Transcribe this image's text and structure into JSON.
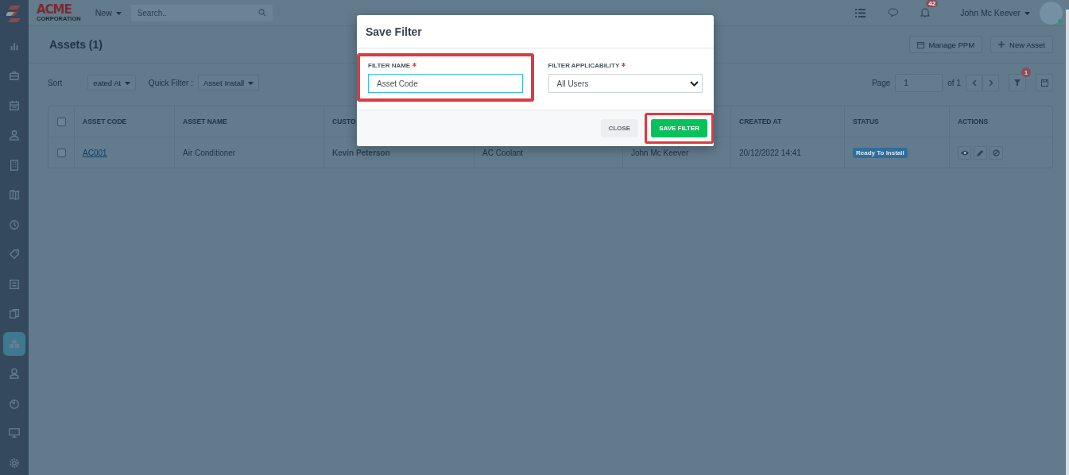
{
  "sidebar": {
    "items": [
      {
        "selected": false
      },
      {
        "selected": false
      },
      {
        "selected": false
      },
      {
        "selected": false
      },
      {
        "selected": false
      },
      {
        "selected": false
      },
      {
        "selected": false
      },
      {
        "selected": false
      },
      {
        "selected": false
      },
      {
        "selected": false
      },
      {
        "selected": true
      },
      {
        "selected": false
      },
      {
        "selected": false
      },
      {
        "selected": false
      },
      {
        "selected": false
      }
    ]
  },
  "topbar": {
    "logo": {
      "name": "ACME",
      "tagline": "CORPORATION"
    },
    "new_menu": "New",
    "search": {
      "placeholder": "Search.."
    },
    "notifications": "42",
    "user": "John Mc Keever"
  },
  "page": {
    "title": "Assets (1)",
    "buttons": [
      "Manage PPM",
      "New Asset"
    ]
  },
  "toolbar": {
    "sort_label": "Sort",
    "sort_value": "eated At",
    "quick_filter_label": "Quick Filter :",
    "quick_filter_value": "Asset Install",
    "page_label": "Page",
    "page_value": "1",
    "page_of": "of 1",
    "filter_count": "1"
  },
  "table": {
    "columns": [
      {
        "label": "ASSET CODE"
      },
      {
        "label": "ASSET NAME"
      },
      {
        "label": "CUSTO"
      },
      {},
      {},
      {
        "label": "CREATED AT"
      },
      {
        "label": "STATUS"
      },
      {
        "label": "ACTIONS"
      }
    ],
    "rows": [
      {
        "checked": false,
        "cells": [
          "AC001",
          "Air Conditioner",
          "Kevin Peterson",
          "AC Coolant",
          "John Mc Keever",
          "20/12/2022 14:41"
        ],
        "status": "Ready To Install"
      }
    ],
    "header_checked": false
  },
  "modal": {
    "title": "Save Filter",
    "fields": [
      {
        "kind": "text",
        "label": "FILTER NAME",
        "required": true,
        "value": "Asset Code",
        "highlighted": true
      },
      {
        "kind": "select",
        "label": "FILTER APPLICABILITY",
        "required": true,
        "value": "All Users",
        "highlighted": false
      }
    ],
    "buttons": [
      {
        "kind": "secondary",
        "label": "CLOSE",
        "highlighted": false
      },
      {
        "kind": "primary",
        "label": "SAVE FILTER",
        "highlighted": true
      }
    ]
  }
}
